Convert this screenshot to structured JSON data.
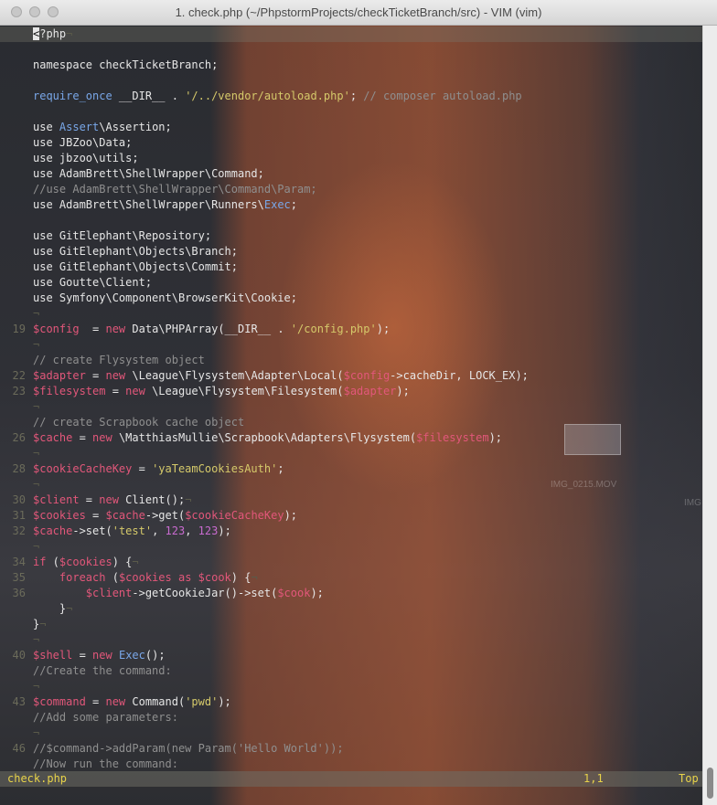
{
  "window": {
    "title": "1. check.php (~/PhpstormProjects/checkTicketBranch/src) - VIM (vim)"
  },
  "colors": {
    "text": "#e6e6e6",
    "line_number": "#6b6b5a",
    "keyword": "#79a7e8",
    "string": "#d5c96a",
    "variable": "#e2577a",
    "comment": "#8f8f8f",
    "number": "#c96bd0",
    "status": "#e8d34a"
  },
  "editor": {
    "lines": [
      {
        "n": "",
        "cursor": true,
        "tokens": [
          {
            "t": "<",
            "c": "cursor"
          },
          {
            "t": "?php",
            "c": "text"
          },
          {
            "t": "¬",
            "c": "nl"
          }
        ]
      },
      {
        "n": "",
        "tokens": []
      },
      {
        "n": "",
        "tokens": [
          {
            "t": "namespace checkTicketBranch;",
            "c": "text"
          }
        ]
      },
      {
        "n": "",
        "tokens": []
      },
      {
        "n": "",
        "tokens": [
          {
            "t": "require_once",
            "c": "keyword"
          },
          {
            "t": " __DIR__ . ",
            "c": "text"
          },
          {
            "t": "'/../vendor/autoload.php'",
            "c": "string"
          },
          {
            "t": "; ",
            "c": "text"
          },
          {
            "t": "// composer autoload.php",
            "c": "comment"
          }
        ]
      },
      {
        "n": "",
        "tokens": []
      },
      {
        "n": "",
        "tokens": [
          {
            "t": "use ",
            "c": "text"
          },
          {
            "t": "Assert",
            "c": "keyword"
          },
          {
            "t": "\\Assertion;",
            "c": "text"
          }
        ]
      },
      {
        "n": "",
        "tokens": [
          {
            "t": "use JBZoo\\Data;",
            "c": "text"
          }
        ]
      },
      {
        "n": "",
        "tokens": [
          {
            "t": "use jbzoo\\utils;",
            "c": "text"
          }
        ]
      },
      {
        "n": "",
        "tokens": [
          {
            "t": "use AdamBrett\\ShellWrapper\\Command;",
            "c": "text"
          }
        ]
      },
      {
        "n": "",
        "tokens": [
          {
            "t": "//use AdamBrett\\ShellWrapper\\Command\\Param;",
            "c": "comment"
          }
        ]
      },
      {
        "n": "",
        "tokens": [
          {
            "t": "use AdamBrett\\ShellWrapper\\Runners\\",
            "c": "text"
          },
          {
            "t": "Exec",
            "c": "keyword"
          },
          {
            "t": ";",
            "c": "text"
          }
        ]
      },
      {
        "n": "",
        "tokens": []
      },
      {
        "n": "",
        "tokens": [
          {
            "t": "use GitElephant\\Repository;",
            "c": "text"
          }
        ]
      },
      {
        "n": "",
        "tokens": [
          {
            "t": "use GitElephant\\Objects\\Branch;",
            "c": "text"
          }
        ]
      },
      {
        "n": "",
        "tokens": [
          {
            "t": "use GitElephant\\Objects\\Commit;",
            "c": "text"
          }
        ]
      },
      {
        "n": "",
        "tokens": [
          {
            "t": "use Goutte\\Client;",
            "c": "text"
          }
        ]
      },
      {
        "n": "",
        "tokens": [
          {
            "t": "use Symfony\\Component\\BrowserKit\\Cookie;",
            "c": "text"
          }
        ]
      },
      {
        "n": "",
        "tokens": [
          {
            "t": "¬",
            "c": "nl"
          }
        ]
      },
      {
        "n": "19",
        "tokens": [
          {
            "t": "$config",
            "c": "variable"
          },
          {
            "t": "  = ",
            "c": "text"
          },
          {
            "t": "new",
            "c": "variable"
          },
          {
            "t": " Data\\PHPArray(__DIR__ . ",
            "c": "text"
          },
          {
            "t": "'/config.php'",
            "c": "string"
          },
          {
            "t": ");",
            "c": "text"
          }
        ]
      },
      {
        "n": "",
        "tokens": [
          {
            "t": "¬",
            "c": "nl"
          }
        ]
      },
      {
        "n": "",
        "tokens": [
          {
            "t": "// create Flysystem object",
            "c": "comment"
          }
        ]
      },
      {
        "n": "22",
        "tokens": [
          {
            "t": "$adapter",
            "c": "variable"
          },
          {
            "t": " = ",
            "c": "text"
          },
          {
            "t": "new",
            "c": "variable"
          },
          {
            "t": " \\League\\Flysystem\\Adapter\\Local(",
            "c": "text"
          },
          {
            "t": "$config",
            "c": "variable"
          },
          {
            "t": "->cacheDir, LOCK_EX);",
            "c": "text"
          }
        ]
      },
      {
        "n": "23",
        "tokens": [
          {
            "t": "$filesystem",
            "c": "variable"
          },
          {
            "t": " = ",
            "c": "text"
          },
          {
            "t": "new",
            "c": "variable"
          },
          {
            "t": " \\League\\Flysystem\\Filesystem(",
            "c": "text"
          },
          {
            "t": "$adapter",
            "c": "variable"
          },
          {
            "t": ");",
            "c": "text"
          }
        ]
      },
      {
        "n": "",
        "tokens": [
          {
            "t": "¬",
            "c": "nl"
          }
        ]
      },
      {
        "n": "",
        "tokens": [
          {
            "t": "// create Scrapbook cache object",
            "c": "comment"
          }
        ]
      },
      {
        "n": "26",
        "tokens": [
          {
            "t": "$cache",
            "c": "variable"
          },
          {
            "t": " = ",
            "c": "text"
          },
          {
            "t": "new",
            "c": "variable"
          },
          {
            "t": " \\MatthiasMullie\\Scrapbook\\Adapters\\Flysystem(",
            "c": "text"
          },
          {
            "t": "$filesystem",
            "c": "variable"
          },
          {
            "t": ");",
            "c": "text"
          }
        ]
      },
      {
        "n": "",
        "tokens": [
          {
            "t": "¬",
            "c": "nl"
          }
        ]
      },
      {
        "n": "28",
        "tokens": [
          {
            "t": "$cookieCacheKey",
            "c": "variable"
          },
          {
            "t": " = ",
            "c": "text"
          },
          {
            "t": "'yaTeamCookiesAuth'",
            "c": "string"
          },
          {
            "t": ";",
            "c": "text"
          }
        ]
      },
      {
        "n": "",
        "tokens": [
          {
            "t": "¬",
            "c": "nl"
          }
        ]
      },
      {
        "n": "30",
        "tokens": [
          {
            "t": "$client",
            "c": "variable"
          },
          {
            "t": " = ",
            "c": "text"
          },
          {
            "t": "new",
            "c": "variable"
          },
          {
            "t": " Client();",
            "c": "text"
          },
          {
            "t": "¬",
            "c": "nl"
          }
        ]
      },
      {
        "n": "31",
        "tokens": [
          {
            "t": "$cookies",
            "c": "variable"
          },
          {
            "t": " = ",
            "c": "text"
          },
          {
            "t": "$cache",
            "c": "variable"
          },
          {
            "t": "->get(",
            "c": "text"
          },
          {
            "t": "$cookieCacheKey",
            "c": "variable"
          },
          {
            "t": ");",
            "c": "text"
          }
        ]
      },
      {
        "n": "32",
        "tokens": [
          {
            "t": "$cache",
            "c": "variable"
          },
          {
            "t": "->set(",
            "c": "text"
          },
          {
            "t": "'test'",
            "c": "string"
          },
          {
            "t": ", ",
            "c": "text"
          },
          {
            "t": "123",
            "c": "number"
          },
          {
            "t": ", ",
            "c": "text"
          },
          {
            "t": "123",
            "c": "number"
          },
          {
            "t": ");",
            "c": "text"
          }
        ]
      },
      {
        "n": "",
        "tokens": [
          {
            "t": "¬",
            "c": "nl"
          }
        ]
      },
      {
        "n": "34",
        "tokens": [
          {
            "t": "if",
            "c": "variable"
          },
          {
            "t": " (",
            "c": "text"
          },
          {
            "t": "$cookies",
            "c": "variable"
          },
          {
            "t": ") {",
            "c": "text"
          },
          {
            "t": "¬",
            "c": "nl"
          }
        ]
      },
      {
        "n": "35",
        "tokens": [
          {
            "t": "    ",
            "c": "text"
          },
          {
            "t": "foreach",
            "c": "variable"
          },
          {
            "t": " (",
            "c": "text"
          },
          {
            "t": "$cookies",
            "c": "variable"
          },
          {
            "t": " ",
            "c": "text"
          },
          {
            "t": "as",
            "c": "variable"
          },
          {
            "t": " ",
            "c": "text"
          },
          {
            "t": "$cook",
            "c": "variable"
          },
          {
            "t": ") {",
            "c": "text"
          },
          {
            "t": "¬",
            "c": "nl"
          }
        ]
      },
      {
        "n": "36",
        "tokens": [
          {
            "t": "        ",
            "c": "text"
          },
          {
            "t": "$client",
            "c": "variable"
          },
          {
            "t": "->getCookieJar()->set(",
            "c": "text"
          },
          {
            "t": "$cook",
            "c": "variable"
          },
          {
            "t": ");",
            "c": "text"
          }
        ]
      },
      {
        "n": "",
        "tokens": [
          {
            "t": "    }",
            "c": "text"
          },
          {
            "t": "¬",
            "c": "nl"
          }
        ]
      },
      {
        "n": "",
        "tokens": [
          {
            "t": "}",
            "c": "text"
          },
          {
            "t": "¬",
            "c": "nl"
          }
        ]
      },
      {
        "n": "",
        "tokens": [
          {
            "t": "¬",
            "c": "nl"
          }
        ]
      },
      {
        "n": "40",
        "tokens": [
          {
            "t": "$shell",
            "c": "variable"
          },
          {
            "t": " = ",
            "c": "text"
          },
          {
            "t": "new",
            "c": "variable"
          },
          {
            "t": " ",
            "c": "text"
          },
          {
            "t": "Exec",
            "c": "keyword"
          },
          {
            "t": "();",
            "c": "text"
          }
        ]
      },
      {
        "n": "",
        "tokens": [
          {
            "t": "//Create the command:",
            "c": "comment"
          }
        ]
      },
      {
        "n": "",
        "tokens": [
          {
            "t": "¬",
            "c": "nl"
          }
        ]
      },
      {
        "n": "43",
        "tokens": [
          {
            "t": "$command",
            "c": "variable"
          },
          {
            "t": " = ",
            "c": "text"
          },
          {
            "t": "new",
            "c": "variable"
          },
          {
            "t": " Command(",
            "c": "text"
          },
          {
            "t": "'pwd'",
            "c": "string"
          },
          {
            "t": ");",
            "c": "text"
          }
        ]
      },
      {
        "n": "",
        "tokens": [
          {
            "t": "//Add some parameters:",
            "c": "comment"
          }
        ]
      },
      {
        "n": "",
        "tokens": [
          {
            "t": "¬",
            "c": "nl"
          }
        ]
      },
      {
        "n": "46",
        "tokens": [
          {
            "t": "//$command->addParam(new Param('Hello World'));",
            "c": "comment"
          }
        ]
      },
      {
        "n": "",
        "tokens": [
          {
            "t": "//Now run the command:",
            "c": "comment"
          }
        ]
      }
    ]
  },
  "status": {
    "filename": "check.php",
    "position": "1,1",
    "scroll": "Top"
  },
  "desktop": {
    "file_label": "IMG_0215.MOV",
    "file_label_2": "IMG"
  }
}
